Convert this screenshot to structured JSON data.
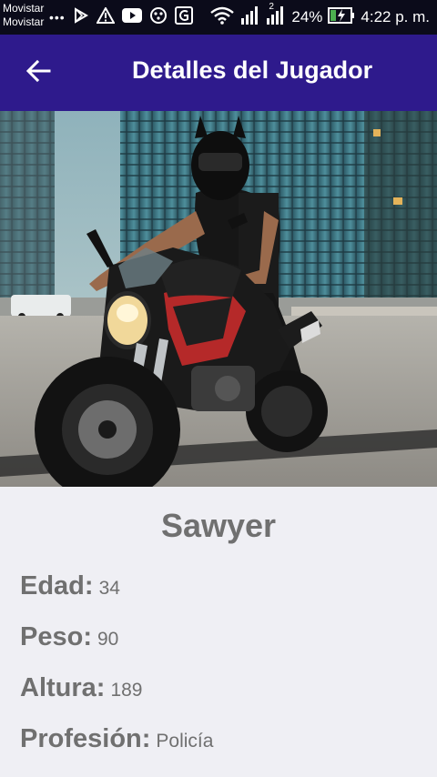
{
  "status_bar": {
    "carrier_1": "Movistar",
    "carrier_2": "Movistar",
    "overflow": "•••",
    "sim_index": "2",
    "battery": "24%",
    "time": "4:22 p. m.",
    "icons_left": [
      "play-store-icon",
      "warning-icon",
      "youtube-icon",
      "drive-icon",
      "gallery-icon"
    ],
    "icons_right": [
      "wifi-icon",
      "signal-icon",
      "signal-icon",
      "battery-charging-icon"
    ]
  },
  "app_bar": {
    "title": "Detalles del Jugador",
    "back_icon": "arrow-left-icon",
    "background": "#2e1a8c"
  },
  "player": {
    "name": "Sawyer",
    "fields": [
      {
        "label": "Edad:",
        "value": "34"
      },
      {
        "label": "Peso:",
        "value": "90"
      },
      {
        "label": "Altura:",
        "value": "189"
      },
      {
        "label": "Profesión:",
        "value": "Policía"
      }
    ]
  },
  "colors": {
    "text_gray": "#707070",
    "page_bg": "#efeff4",
    "status_bg": "#0b0b1a"
  }
}
